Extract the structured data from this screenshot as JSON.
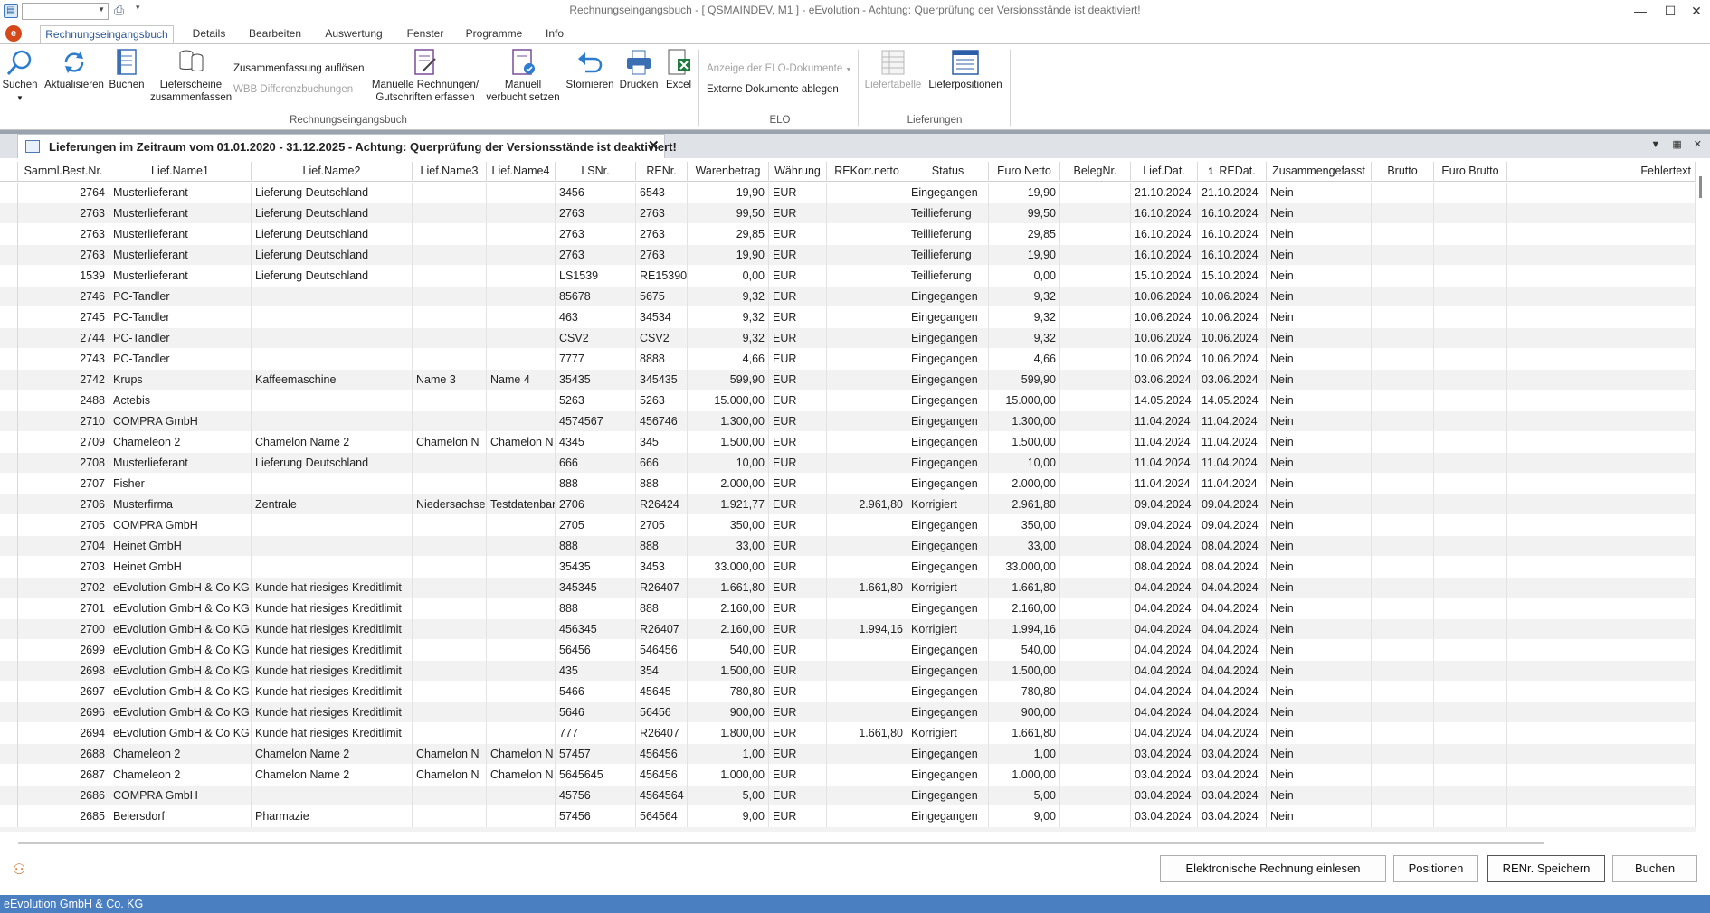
{
  "window": {
    "title": "Rechnungseingangsbuch - [ QSMAINDEV, M1 ]  -  eEvolution - Achtung: Querprüfung der Versionsstände ist deaktiviert!",
    "minimize": "—",
    "maximize": "☐",
    "close": "✕"
  },
  "ribbon_tabs": [
    "Rechnungseingangsbuch",
    "Details",
    "Bearbeiten",
    "Auswertung",
    "Fenster",
    "Programme",
    "Info"
  ],
  "ribbon": {
    "suchen": "Suchen",
    "aktualisieren": "Aktualisieren",
    "buchen": "Buchen",
    "lieferscheine_1": "Lieferscheine",
    "lieferscheine_2": "zusammenfassen",
    "zusammenfassung_aufloesen": "Zusammenfassung  auflösen",
    "wbb_differenzbuchungen": "WBB Differenzbuchungen",
    "manuelle_1": "Manuelle Rechnungen/",
    "manuelle_2": "Gutschriften erfassen",
    "manuell_verbucht_1": "Manuell",
    "manuell_verbucht_2": "verbucht setzen",
    "stornieren": "Stornieren",
    "drucken": "Drucken",
    "excel": "Excel",
    "group_rechnungseingangsbuch": "Rechnungseingangsbuch",
    "elo_anzeige": "Anzeige der ELO-Dokumente",
    "elo_ablegen": "Externe Dokumente ablegen",
    "group_elo": "ELO",
    "liefertabelle": "Liefertabelle",
    "lieferpositionen": "Lieferpositionen",
    "group_lieferungen": "Lieferungen"
  },
  "doc_tab": {
    "title": "Lieferungen im Zeitraum vom 01.01.2020 - 31.12.2025 - Achtung: Querprüfung der Versionsstände ist deaktiviert!",
    "close": "✕"
  },
  "columns": [
    "Samml.Best.Nr.",
    "Lief.Name1",
    "Lief.Name2",
    "Lief.Name3",
    "Lief.Name4",
    "LSNr.",
    "RENr.",
    "Warenbetrag",
    "Währung",
    "REKorr.netto",
    "Status",
    "Euro Netto",
    "BelegNr.",
    "Lief.Dat.",
    "REDat.",
    "Zusammengefasst",
    "Brutto",
    "Euro Brutto",
    "Fehlertext"
  ],
  "sort_indicator": "1",
  "rows": [
    [
      "2764",
      "Musterlieferant",
      "Lieferung Deutschland",
      "",
      "",
      "3456",
      "6543",
      "19,90",
      "EUR",
      "",
      "Eingegangen",
      "19,90",
      "",
      "21.10.2024",
      "21.10.2024",
      "Nein",
      "",
      "",
      ""
    ],
    [
      "2763",
      "Musterlieferant",
      "Lieferung Deutschland",
      "",
      "",
      "2763",
      "2763",
      "99,50",
      "EUR",
      "",
      "Teillieferung",
      "99,50",
      "",
      "16.10.2024",
      "16.10.2024",
      "Nein",
      "",
      "",
      ""
    ],
    [
      "2763",
      "Musterlieferant",
      "Lieferung Deutschland",
      "",
      "",
      "2763",
      "2763",
      "29,85",
      "EUR",
      "",
      "Teillieferung",
      "29,85",
      "",
      "16.10.2024",
      "16.10.2024",
      "Nein",
      "",
      "",
      ""
    ],
    [
      "2763",
      "Musterlieferant",
      "Lieferung Deutschland",
      "",
      "",
      "2763",
      "2763",
      "19,90",
      "EUR",
      "",
      "Teillieferung",
      "19,90",
      "",
      "16.10.2024",
      "16.10.2024",
      "Nein",
      "",
      "",
      ""
    ],
    [
      "1539",
      "Musterlieferant",
      "Lieferung Deutschland",
      "",
      "",
      "LS1539",
      "RE15390",
      "0,00",
      "EUR",
      "",
      "Teillieferung",
      "0,00",
      "",
      "15.10.2024",
      "15.10.2024",
      "Nein",
      "",
      "",
      ""
    ],
    [
      "2746",
      "PC-Tandler",
      "",
      "",
      "",
      "85678",
      "5675",
      "9,32",
      "EUR",
      "",
      "Eingegangen",
      "9,32",
      "",
      "10.06.2024",
      "10.06.2024",
      "Nein",
      "",
      "",
      ""
    ],
    [
      "2745",
      "PC-Tandler",
      "",
      "",
      "",
      "463",
      "34534",
      "9,32",
      "EUR",
      "",
      "Eingegangen",
      "9,32",
      "",
      "10.06.2024",
      "10.06.2024",
      "Nein",
      "",
      "",
      ""
    ],
    [
      "2744",
      "PC-Tandler",
      "",
      "",
      "",
      "CSV2",
      "CSV2",
      "9,32",
      "EUR",
      "",
      "Eingegangen",
      "9,32",
      "",
      "10.06.2024",
      "10.06.2024",
      "Nein",
      "",
      "",
      ""
    ],
    [
      "2743",
      "PC-Tandler",
      "",
      "",
      "",
      "7777",
      "8888",
      "4,66",
      "EUR",
      "",
      "Eingegangen",
      "4,66",
      "",
      "10.06.2024",
      "10.06.2024",
      "Nein",
      "",
      "",
      ""
    ],
    [
      "2742",
      "Krups",
      "Kaffeemaschine",
      "Name 3",
      "Name 4",
      "35435",
      "345435",
      "599,90",
      "EUR",
      "",
      "Eingegangen",
      "599,90",
      "",
      "03.06.2024",
      "03.06.2024",
      "Nein",
      "",
      "",
      ""
    ],
    [
      "2488",
      "Actebis",
      "",
      "",
      "",
      "5263",
      "5263",
      "15.000,00",
      "EUR",
      "",
      "Eingegangen",
      "15.000,00",
      "",
      "14.05.2024",
      "14.05.2024",
      "Nein",
      "",
      "",
      ""
    ],
    [
      "2710",
      "COMPRA GmbH",
      "",
      "",
      "",
      "4574567",
      "456746",
      "1.300,00",
      "EUR",
      "",
      "Eingegangen",
      "1.300,00",
      "",
      "11.04.2024",
      "11.04.2024",
      "Nein",
      "",
      "",
      ""
    ],
    [
      "2709",
      "Chameleon 2",
      "Chamelon Name 2",
      "Chamelon  N",
      "Chamelon  N",
      "4345",
      "345",
      "1.500,00",
      "EUR",
      "",
      "Eingegangen",
      "1.500,00",
      "",
      "11.04.2024",
      "11.04.2024",
      "Nein",
      "",
      "",
      ""
    ],
    [
      "2708",
      "Musterlieferant",
      "Lieferung Deutschland",
      "",
      "",
      "666",
      "666",
      "10,00",
      "EUR",
      "",
      "Eingegangen",
      "10,00",
      "",
      "11.04.2024",
      "11.04.2024",
      "Nein",
      "",
      "",
      ""
    ],
    [
      "2707",
      "Fisher",
      "",
      "",
      "",
      "888",
      "888",
      "2.000,00",
      "EUR",
      "",
      "Eingegangen",
      "2.000,00",
      "",
      "11.04.2024",
      "11.04.2024",
      "Nein",
      "",
      "",
      ""
    ],
    [
      "2706",
      "Musterfirma",
      "Zentrale",
      "Niedersachse",
      "Testdatenbar",
      "2706",
      "R26424",
      "1.921,77",
      "EUR",
      "2.961,80",
      "Korrigiert",
      "2.961,80",
      "",
      "09.04.2024",
      "09.04.2024",
      "Nein",
      "",
      "",
      ""
    ],
    [
      "2705",
      "COMPRA GmbH",
      "",
      "",
      "",
      "2705",
      "2705",
      "350,00",
      "EUR",
      "",
      "Eingegangen",
      "350,00",
      "",
      "09.04.2024",
      "09.04.2024",
      "Nein",
      "",
      "",
      ""
    ],
    [
      "2704",
      "Heinet GmbH",
      "",
      "",
      "",
      "888",
      "888",
      "33,00",
      "EUR",
      "",
      "Eingegangen",
      "33,00",
      "",
      "08.04.2024",
      "08.04.2024",
      "Nein",
      "",
      "",
      ""
    ],
    [
      "2703",
      "Heinet GmbH",
      "",
      "",
      "",
      "35435",
      "3453",
      "33.000,00",
      "EUR",
      "",
      "Eingegangen",
      "33.000,00",
      "",
      "08.04.2024",
      "08.04.2024",
      "Nein",
      "",
      "",
      ""
    ],
    [
      "2702",
      "eEvolution GmbH & Co KG",
      "Kunde hat riesiges Kreditlimit",
      "",
      "",
      "345345",
      "R26407",
      "1.661,80",
      "EUR",
      "1.661,80",
      "Korrigiert",
      "1.661,80",
      "",
      "04.04.2024",
      "04.04.2024",
      "Nein",
      "",
      "",
      ""
    ],
    [
      "2701",
      "eEvolution GmbH & Co KG",
      "Kunde hat riesiges Kreditlimit",
      "",
      "",
      "888",
      "888",
      "2.160,00",
      "EUR",
      "",
      "Eingegangen",
      "2.160,00",
      "",
      "04.04.2024",
      "04.04.2024",
      "Nein",
      "",
      "",
      ""
    ],
    [
      "2700",
      "eEvolution GmbH & Co KG",
      "Kunde hat riesiges Kreditlimit",
      "",
      "",
      "456345",
      "R26407",
      "2.160,00",
      "EUR",
      "1.994,16",
      "Korrigiert",
      "1.994,16",
      "",
      "04.04.2024",
      "04.04.2024",
      "Nein",
      "",
      "",
      ""
    ],
    [
      "2699",
      "eEvolution GmbH & Co KG",
      "Kunde hat riesiges Kreditlimit",
      "",
      "",
      "56456",
      "546456",
      "540,00",
      "EUR",
      "",
      "Eingegangen",
      "540,00",
      "",
      "04.04.2024",
      "04.04.2024",
      "Nein",
      "",
      "",
      ""
    ],
    [
      "2698",
      "eEvolution GmbH & Co KG",
      "Kunde hat riesiges Kreditlimit",
      "",
      "",
      "435",
      "354",
      "1.500,00",
      "EUR",
      "",
      "Eingegangen",
      "1.500,00",
      "",
      "04.04.2024",
      "04.04.2024",
      "Nein",
      "",
      "",
      ""
    ],
    [
      "2697",
      "eEvolution GmbH & Co KG",
      "Kunde hat riesiges Kreditlimit",
      "",
      "",
      "5466",
      "45645",
      "780,80",
      "EUR",
      "",
      "Eingegangen",
      "780,80",
      "",
      "04.04.2024",
      "04.04.2024",
      "Nein",
      "",
      "",
      ""
    ],
    [
      "2696",
      "eEvolution GmbH & Co KG",
      "Kunde hat riesiges Kreditlimit",
      "",
      "",
      "5646",
      "56456",
      "900,00",
      "EUR",
      "",
      "Eingegangen",
      "900,00",
      "",
      "04.04.2024",
      "04.04.2024",
      "Nein",
      "",
      "",
      ""
    ],
    [
      "2694",
      "eEvolution GmbH & Co KG",
      "Kunde hat riesiges Kreditlimit",
      "",
      "",
      "777",
      "R26407",
      "1.800,00",
      "EUR",
      "1.661,80",
      "Korrigiert",
      "1.661,80",
      "",
      "04.04.2024",
      "04.04.2024",
      "Nein",
      "",
      "",
      ""
    ],
    [
      "2688",
      "Chameleon 2",
      "Chamelon Name 2",
      "Chamelon  N",
      "Chamelon  N",
      "57457",
      "456456",
      "1,00",
      "EUR",
      "",
      "Eingegangen",
      "1,00",
      "",
      "03.04.2024",
      "03.04.2024",
      "Nein",
      "",
      "",
      ""
    ],
    [
      "2687",
      "Chameleon 2",
      "Chamelon Name 2",
      "Chamelon  N",
      "Chamelon  N",
      "5645645",
      "456456",
      "1.000,00",
      "EUR",
      "",
      "Eingegangen",
      "1.000,00",
      "",
      "03.04.2024",
      "03.04.2024",
      "Nein",
      "",
      "",
      ""
    ],
    [
      "2686",
      "COMPRA GmbH",
      "",
      "",
      "",
      "45756",
      "4564564",
      "5,00",
      "EUR",
      "",
      "Eingegangen",
      "5,00",
      "",
      "03.04.2024",
      "03.04.2024",
      "Nein",
      "",
      "",
      ""
    ],
    [
      "2685",
      "Beiersdorf",
      "Pharmazie",
      "",
      "",
      "57456",
      "564564",
      "9,00",
      "EUR",
      "",
      "Eingegangen",
      "9,00",
      "",
      "03.04.2024",
      "03.04.2024",
      "Nein",
      "",
      "",
      ""
    ]
  ],
  "buttons": {
    "elektronische_rechnung": "Elektronische Rechnung einlesen",
    "positionen": "Positionen",
    "renr_speichern": "RENr. Speichern",
    "buchen": "Buchen"
  },
  "statusbar": "eEvolution GmbH & Co. KG"
}
